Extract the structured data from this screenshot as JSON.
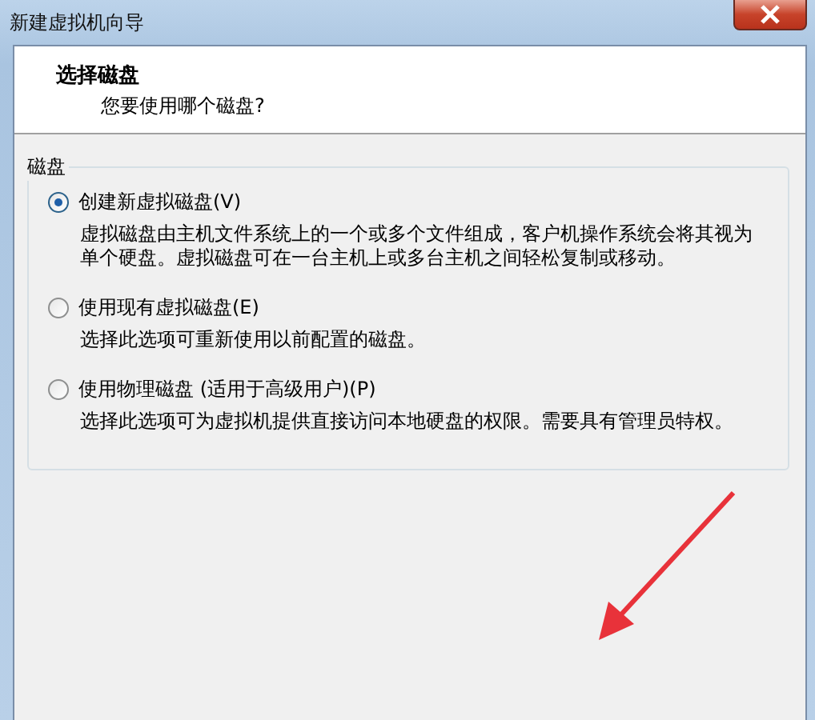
{
  "window": {
    "title": "新建虚拟机向导"
  },
  "header": {
    "title": "选择磁盘",
    "subtitle": "您要使用哪个磁盘?"
  },
  "group": {
    "label": "磁盘",
    "options": [
      {
        "label": "创建新虚拟磁盘(V)",
        "selected": true,
        "description": "虚拟磁盘由主机文件系统上的一个或多个文件组成，客户机操作系统会将其视为单个硬盘。虚拟磁盘可在一台主机上或多台主机之间轻松复制或移动。"
      },
      {
        "label": "使用现有虚拟磁盘(E)",
        "selected": false,
        "description": "选择此选项可重新使用以前配置的磁盘。"
      },
      {
        "label": "使用物理磁盘 (适用于高级用户)(P)",
        "selected": false,
        "description": "选择此选项可为虚拟机提供直接访问本地硬盘的权限。需要具有管理员特权。"
      }
    ]
  }
}
